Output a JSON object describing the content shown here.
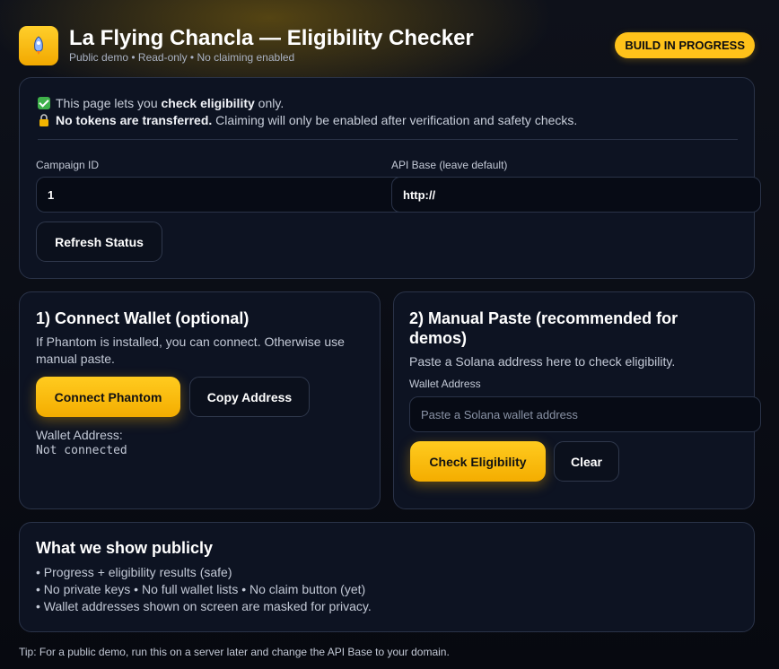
{
  "header": {
    "logo_icon": "rocket-icon",
    "title": "La Flying Chancla — Eligibility Checker",
    "subtitle": "Public demo • Read-only • No claiming enabled",
    "badge": "BUILD IN PROGRESS"
  },
  "notice": {
    "line1_prefix": "This page lets you ",
    "line1_bold": "check eligibility",
    "line1_suffix": " only.",
    "line2_bold": "No tokens are transferred.",
    "line2_suffix": " Claiming will only be enabled after verification and safety checks."
  },
  "settings": {
    "campaign_label": "Campaign ID",
    "campaign_value": "1",
    "api_label": "API Base (leave default)",
    "api_value": "http://",
    "refresh_button": "Refresh Status"
  },
  "connect": {
    "title": "1) Connect Wallet (optional)",
    "description": "If Phantom is installed, you can connect. Otherwise use manual paste.",
    "connect_button": "Connect Phantom",
    "copy_button": "Copy Address",
    "address_label": "Wallet Address:",
    "address_value": "Not connected"
  },
  "manual": {
    "title": "2) Manual Paste (recommended for demos)",
    "description": "Paste a Solana address here to check eligibility.",
    "address_label": "Wallet Address",
    "address_placeholder": "Paste a Solana wallet address",
    "check_button": "Check Eligibility",
    "clear_button": "Clear"
  },
  "public": {
    "title": "What we show publicly",
    "bullets": [
      "• Progress + eligibility results (safe)",
      "• No private keys • No full wallet lists • No claim button (yet)",
      "• Wallet addresses shown on screen are masked for privacy."
    ]
  },
  "tip": "Tip: For a public demo, run this on a server later and change the API Base to your domain.",
  "colors": {
    "accent": "#ffc21a",
    "background": "#0a0d16",
    "card": "#0d1322"
  }
}
